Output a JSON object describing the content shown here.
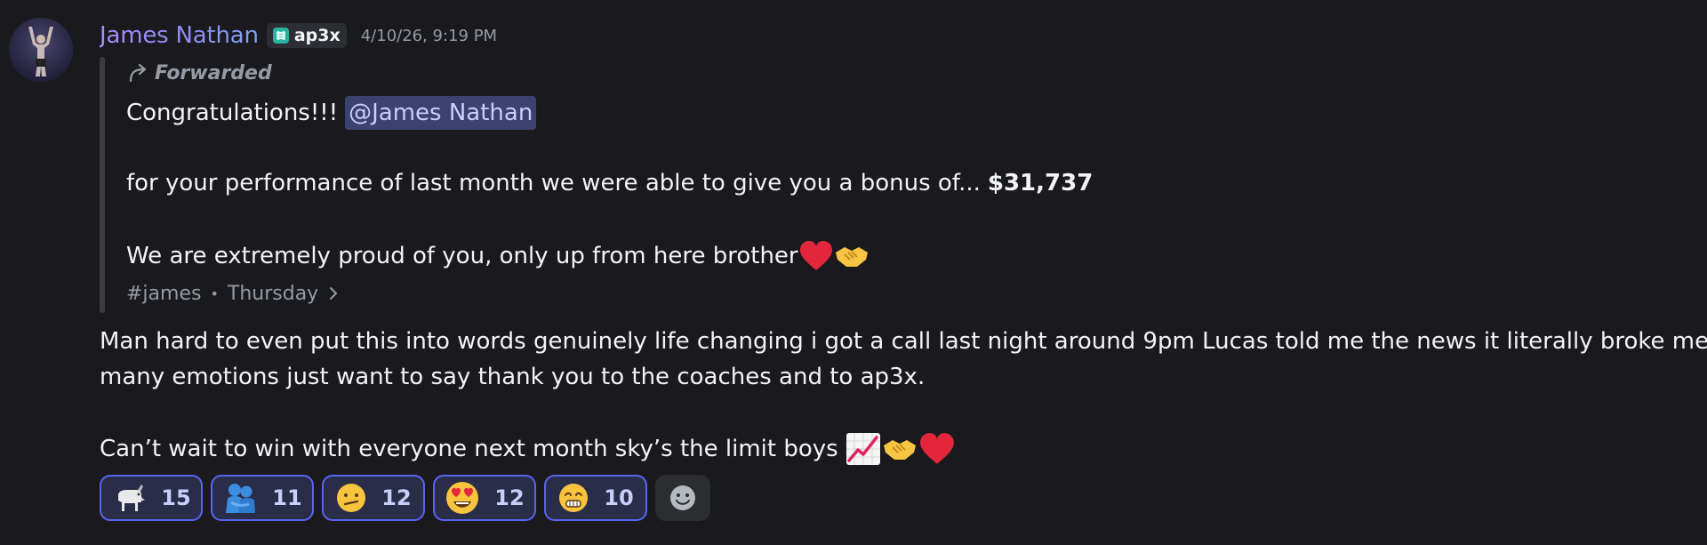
{
  "message": {
    "author": "James Nathan",
    "tag": "ap3x",
    "timestamp": "4/10/26, 9:19 PM",
    "forwarded_label": "Forwarded",
    "forwarded": {
      "line1_text": "Congratulations!!!",
      "mention": "@James Nathan",
      "line2_text": "for your performance of last month we were able to give you a bonus of...",
      "line2_amount": "$31,737",
      "line3_text": "We are extremely proud of you, only up from here brother",
      "line3_emojis": [
        "red-heart",
        "handshake"
      ],
      "channel": "#james",
      "day": "Thursday"
    },
    "body": {
      "line1": "Man hard to even put this into words genuinely life changing i got a call last night around 9pm Lucas told me the news it literally broke me so",
      "line2": "many emotions just want to say thank you to the coaches and to ap3x.",
      "line3": "Can’t wait to win with everyone next month sky’s the limit boys",
      "line3_emojis": [
        "chart-increasing",
        "handshake",
        "red-heart"
      ]
    },
    "reactions": [
      {
        "emoji": "goat",
        "count": "15"
      },
      {
        "emoji": "people-hugging",
        "count": "11"
      },
      {
        "emoji": "face-with-diagonal-mouth",
        "count": "12"
      },
      {
        "emoji": "smiling-face-with-heart-eyes",
        "count": "12"
      },
      {
        "emoji": "grimacing-smile-face",
        "count": "10"
      }
    ],
    "colors": {
      "background": "#1a1a1e",
      "username_gradient_start": "#a98cff",
      "username_gradient_end": "#7fa2f4",
      "reaction_border": "#5865f2",
      "reaction_bg": "#2a2d48",
      "mention_bg": "#3c4270",
      "muted_text": "#949ba4"
    }
  }
}
